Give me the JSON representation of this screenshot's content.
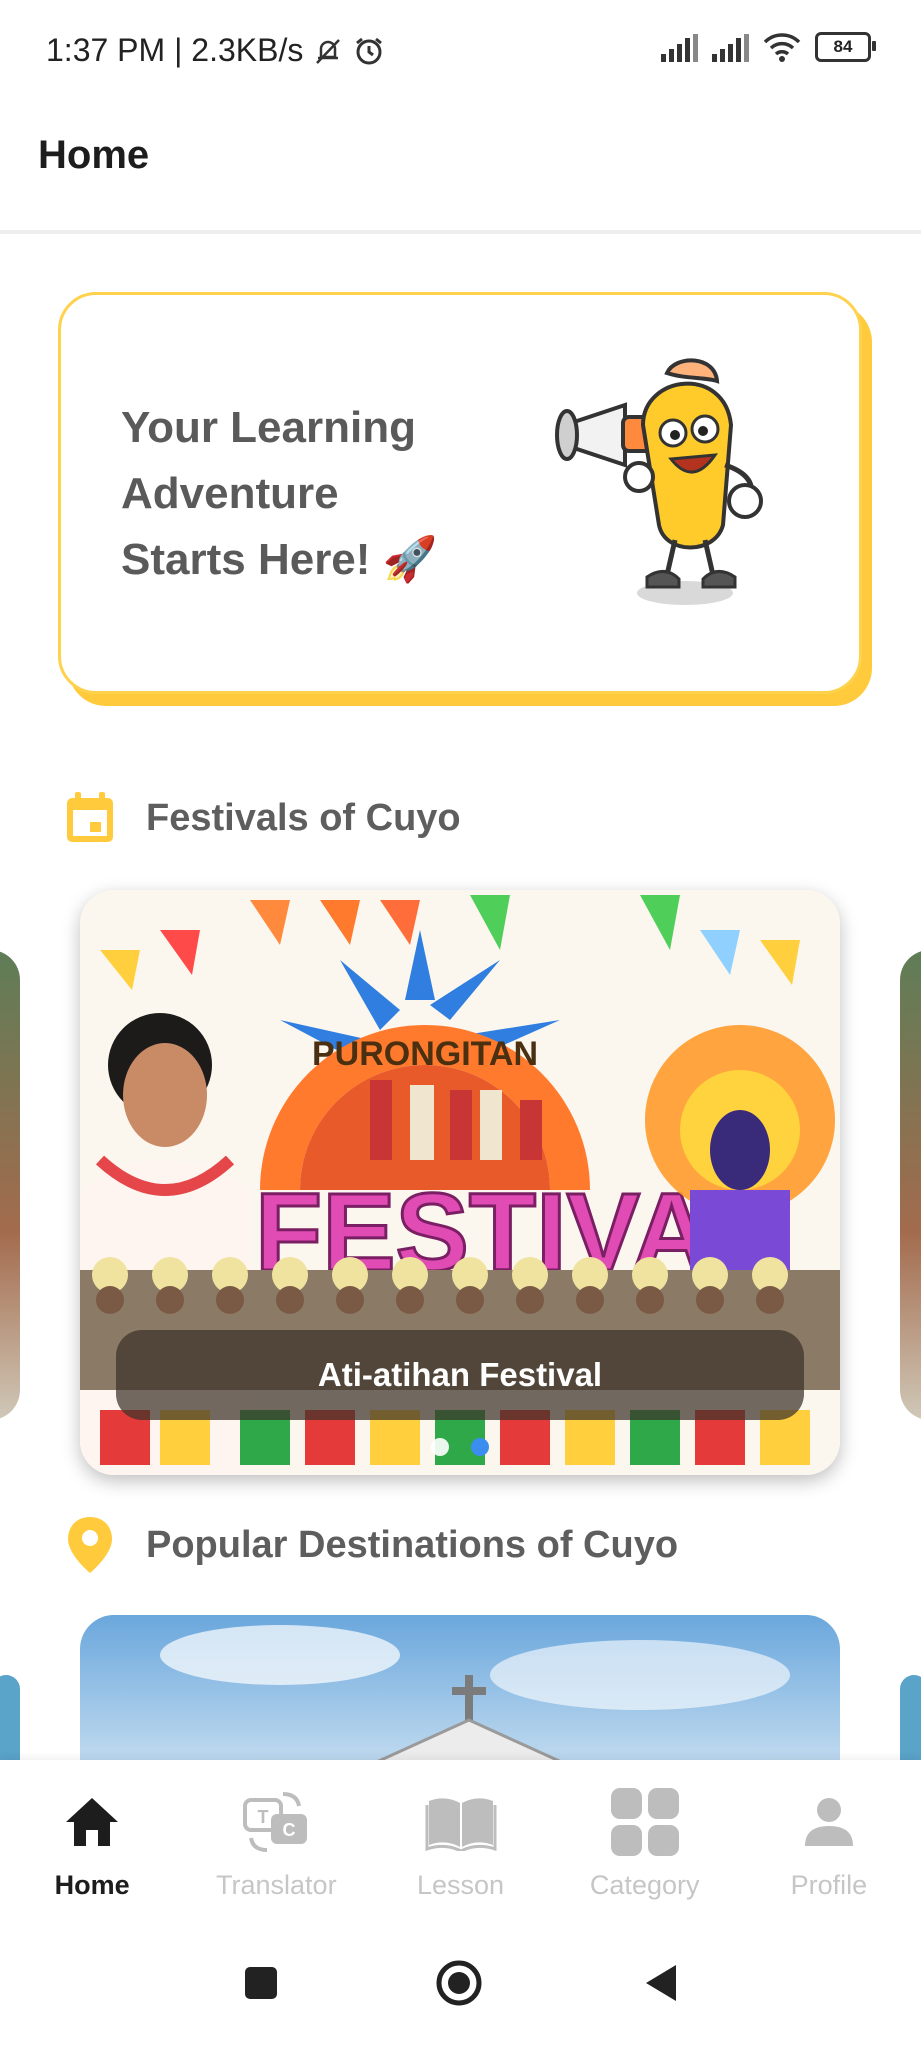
{
  "status_bar": {
    "time_speed": "1:37 PM | 2.3KB/s",
    "icons": [
      "mute-bell-icon",
      "alarm-icon",
      "signal-icon",
      "signal-icon",
      "wifi-icon"
    ],
    "battery": "84"
  },
  "app_bar": {
    "title": "Home"
  },
  "hero": {
    "line1": "Your Learning",
    "line2": "Adventure",
    "line3": "Starts Here! 🚀",
    "mascot_icon": "mascot-megaphone-icon"
  },
  "festivals": {
    "heading": "Festivals of Cuyo",
    "heading_icon": "calendar-icon",
    "card_caption": "Ati-atihan Festival",
    "banner_text_arc": "PURONGITAN",
    "banner_text_big": "FESTIVAL",
    "pager_count": 2,
    "pager_active_index": 1
  },
  "destinations": {
    "heading": "Popular Destinations of Cuyo",
    "heading_icon": "location-pin-icon"
  },
  "bottom_nav": {
    "items": [
      {
        "label": "Home",
        "icon": "home-icon",
        "active": true
      },
      {
        "label": "Translator",
        "icon": "translator-icon",
        "active": false
      },
      {
        "label": "Lesson",
        "icon": "book-icon",
        "active": false
      },
      {
        "label": "Category",
        "icon": "grid-icon",
        "active": false
      },
      {
        "label": "Profile",
        "icon": "person-icon",
        "active": false
      }
    ]
  },
  "system_nav": {
    "buttons": [
      "recents-button",
      "home-button",
      "back-button"
    ]
  },
  "colors": {
    "accent_yellow": "#ffcb3d",
    "active_dot": "#3b8ef0",
    "inactive_nav": "#c6c6c6",
    "heading_text": "#5e5e5e"
  }
}
